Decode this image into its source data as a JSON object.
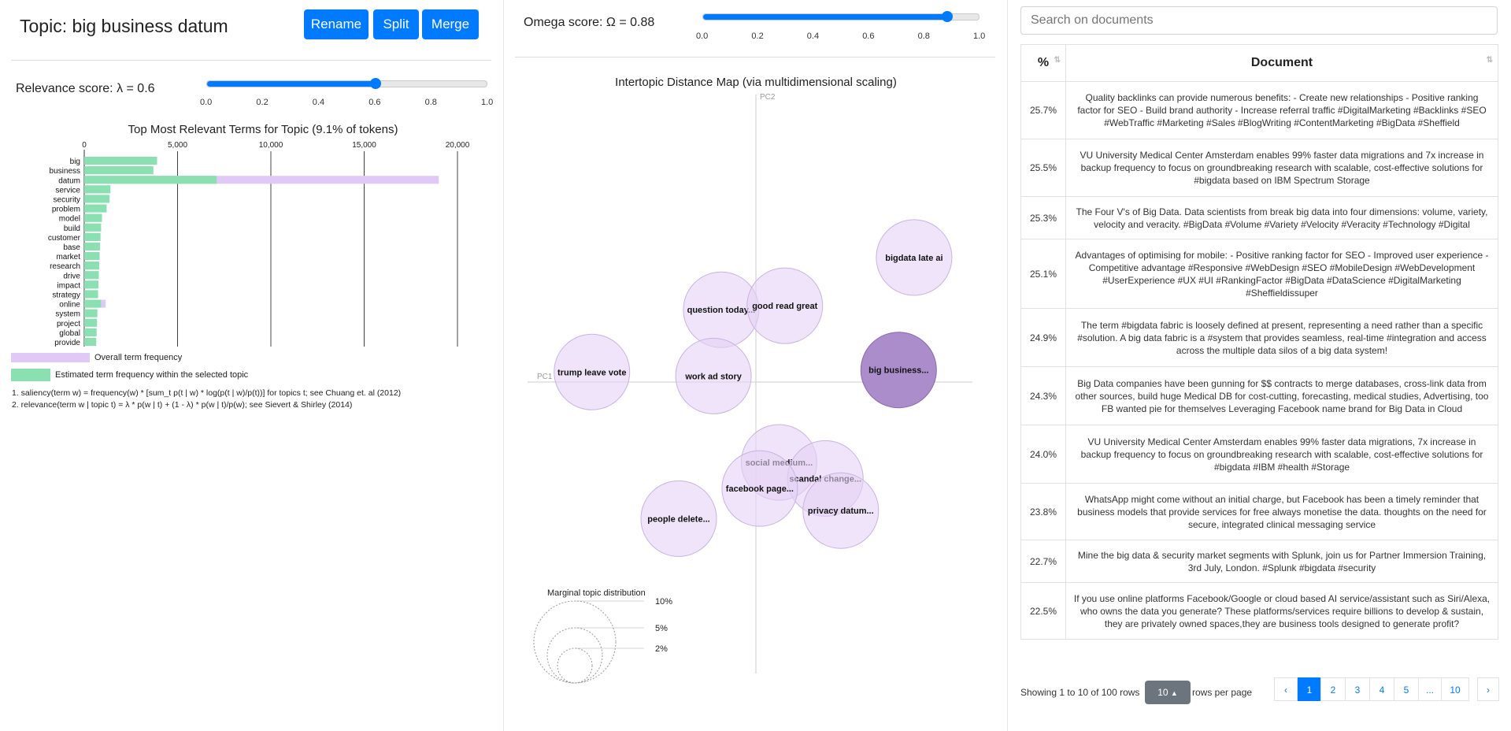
{
  "topic": {
    "title": "Topic: big business datum",
    "buttons": {
      "rename": "Rename",
      "split": "Split",
      "merge": "Merge"
    }
  },
  "relevance": {
    "label": "Relevance score: λ = 0.6",
    "value": 0.6,
    "ticks": [
      "0.0",
      "0.2",
      "0.4",
      "0.6",
      "0.8",
      "1.0"
    ]
  },
  "omega": {
    "label": "Omega score: Ω = 0.88",
    "value": 0.88,
    "ticks": [
      "0.0",
      "0.2",
      "0.4",
      "0.6",
      "0.8",
      "1.0"
    ]
  },
  "chart_data": [
    {
      "type": "bar",
      "title": "Top Most Relevant Terms for Topic (9.1% of tokens)",
      "xlim": [
        0,
        20000
      ],
      "xticks": [
        "0",
        "5,000",
        "10,000",
        "15,000",
        "20,000"
      ],
      "xtick_values": [
        0,
        5000,
        10000,
        15000,
        20000
      ],
      "categories": [
        "big",
        "business",
        "datum",
        "service",
        "security",
        "problem",
        "model",
        "build",
        "customer",
        "base",
        "market",
        "research",
        "drive",
        "impact",
        "strategy",
        "online",
        "system",
        "project",
        "global",
        "provide"
      ],
      "series": [
        {
          "name": "Overall term frequency",
          "color": "#e1c9f7",
          "values": [
            3900,
            3700,
            19000,
            1400,
            1350,
            1200,
            950,
            900,
            870,
            840,
            820,
            800,
            780,
            760,
            740,
            1150,
            700,
            680,
            660,
            640
          ]
        },
        {
          "name": "Estimated term frequency within the selected topic",
          "color": "#8be0b1",
          "values": [
            3900,
            3700,
            7100,
            1400,
            1350,
            1200,
            950,
            900,
            870,
            840,
            820,
            800,
            780,
            760,
            740,
            900,
            700,
            680,
            660,
            640
          ]
        }
      ],
      "legend": [
        "Overall term frequency",
        "Estimated term frequency within the selected topic"
      ],
      "footnotes": [
        "1. saliency(term w) = frequency(w) * [sum_t p(t | w) * log(p(t | w)/p(t))] for topics t; see Chuang et. al (2012)",
        "2. relevance(term w | topic t) = λ * p(w | t) + (1 - λ) * p(w | t)/p(w); see Sievert & Shirley (2014)"
      ]
    },
    {
      "type": "scatter",
      "title": "Intertopic Distance Map (via multidimensional scaling)",
      "xlabel": "PC1",
      "ylabel": "PC2",
      "points": [
        {
          "label": "bigdata late ai",
          "x": 0.82,
          "y": 0.62,
          "selected": false
        },
        {
          "label": "question today...",
          "x": -0.18,
          "y": 0.36,
          "selected": false
        },
        {
          "label": "good read great",
          "x": 0.15,
          "y": 0.38,
          "selected": false
        },
        {
          "label": "trump leave vote",
          "x": -0.85,
          "y": 0.05,
          "selected": false
        },
        {
          "label": "work ad story",
          "x": -0.22,
          "y": 0.03,
          "selected": false
        },
        {
          "label": "big business...",
          "x": 0.74,
          "y": 0.06,
          "selected": true
        },
        {
          "label": "social medium...",
          "x": 0.12,
          "y": -0.4,
          "selected": false
        },
        {
          "label": "scandal change...",
          "x": 0.36,
          "y": -0.48,
          "selected": false
        },
        {
          "label": "facebook page...",
          "x": 0.02,
          "y": -0.53,
          "selected": false
        },
        {
          "label": "privacy datum...",
          "x": 0.44,
          "y": -0.64,
          "selected": false
        },
        {
          "label": "people delete...",
          "x": -0.4,
          "y": -0.68,
          "selected": false
        }
      ],
      "legend_title": "Marginal topic distribution",
      "legend_sizes": [
        "2%",
        "5%",
        "10%"
      ]
    }
  ],
  "search": {
    "placeholder": "Search on documents"
  },
  "table": {
    "headers": {
      "pct": "%",
      "doc": "Document"
    },
    "rows": [
      {
        "pct": "25.7%",
        "doc": "Quality backlinks can provide numerous benefits: - Create new relationships - Positive ranking factor for SEO - Build brand authority - Increase referral traffic #DigitalMarketing #Backlinks #SEO #WebTraffic #Marketing #Sales #BlogWriting #ContentMarketing #BigData #Sheffield"
      },
      {
        "pct": "25.5%",
        "doc": "VU University Medical Center Amsterdam enables 99% faster data migrations and 7x increase in backup frequency to focus on groundbreaking research with scalable, cost-effective solutions for #bigdata based on IBM Spectrum Storage"
      },
      {
        "pct": "25.3%",
        "doc": "The Four V's of Big Data. Data scientists from break big data into four dimensions: volume, variety, velocity and veracity. #BigData #Volume #Variety #Velocity #Veracity #Technology #Digital"
      },
      {
        "pct": "25.1%",
        "doc": "Advantages of optimising for mobile: - Positive ranking factor for SEO - Improved user experience - Competitive advantage #Responsive #WebDesign #SEO #MobileDesign #WebDevelopment #UserExperience #UX #UI #RankingFactor #BigData #DataScience #DigitalMarketing #Sheffieldissuper"
      },
      {
        "pct": "24.9%",
        "doc": "The term #bigdata fabric is loosely defined at present, representing a need rather than a specific #solution. A big data fabric is a #system that provides seamless, real-time #integration and access across the multiple data silos of a big data system!"
      },
      {
        "pct": "24.3%",
        "doc": "Big Data companies have been gunning for $$ contracts to merge databases, cross-link data from other sources, build huge Medical DB for cost-cutting, forecasting, medical studies, Advertising, too FB wanted pie for themselves Leveraging Facebook name brand for Big Data in Cloud"
      },
      {
        "pct": "24.0%",
        "doc": "VU University Medical Center Amsterdam enables 99% faster data migrations, 7x increase in backup frequency to focus on groundbreaking research with scalable, cost-effective solutions for #bigdata #IBM #health #Storage"
      },
      {
        "pct": "23.8%",
        "doc": "WhatsApp might come without an initial charge, but Facebook has been a timely reminder that business models that provide services for free always monetise the data. thoughts on the need for secure, integrated clinical messaging service"
      },
      {
        "pct": "22.7%",
        "doc": "Mine the big data & security market segments with Splunk, join us for Partner Immersion Training, 3rd July, London. #Splunk #bigdata #security"
      },
      {
        "pct": "22.5%",
        "doc": "If you use online platforms Facebook/Google or cloud based AI service/assistant such as Siri/Alexa, who owns the data you generate? These platforms/services require billions to develop & sustain, they are privately owned spaces,they are business tools designed to generate profit?"
      }
    ]
  },
  "pagination": {
    "showing": "Showing 1 to 10 of 100 rows",
    "page_size": "10",
    "rows_per_page": "rows per page",
    "prev": "‹",
    "next": "›",
    "pages": [
      "1",
      "2",
      "3",
      "4",
      "5",
      "...",
      "10"
    ],
    "active_page": "1"
  }
}
